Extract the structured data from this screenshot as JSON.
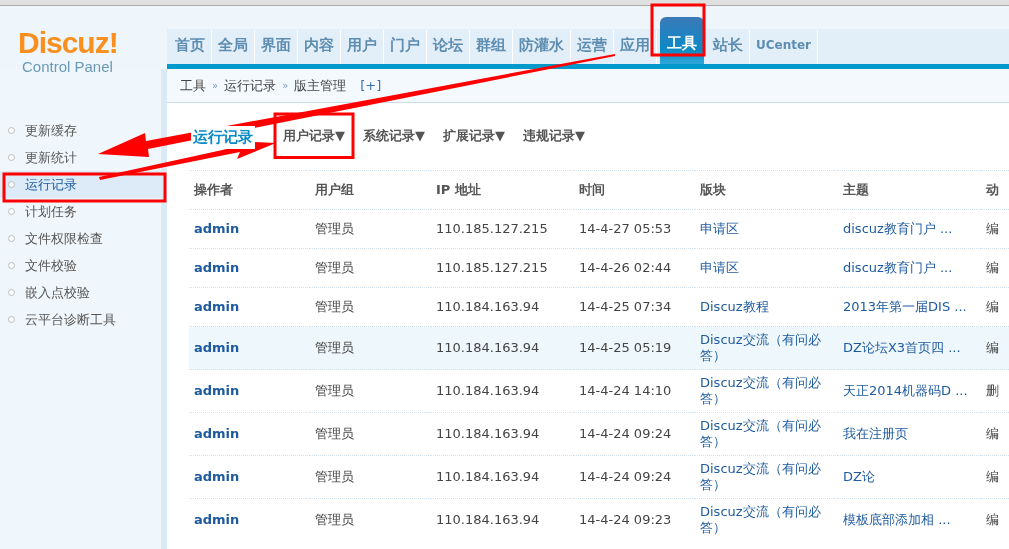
{
  "logo": {
    "title": "Discuz!",
    "subtitle": "Control Panel"
  },
  "nav": [
    {
      "label": "首页",
      "selected": false
    },
    {
      "label": "全局",
      "selected": false
    },
    {
      "label": "界面",
      "selected": false
    },
    {
      "label": "内容",
      "selected": false
    },
    {
      "label": "用户",
      "selected": false
    },
    {
      "label": "门户",
      "selected": false
    },
    {
      "label": "论坛",
      "selected": false
    },
    {
      "label": "群组",
      "selected": false
    },
    {
      "label": "防灌水",
      "selected": false
    },
    {
      "label": "运营",
      "selected": false
    },
    {
      "label": "应用",
      "selected": false
    },
    {
      "label": "工具",
      "selected": true
    },
    {
      "label": "站长",
      "selected": false
    },
    {
      "label": "UCenter",
      "selected": false
    }
  ],
  "breadcrumb": {
    "items": [
      "工具",
      "运行记录",
      "版主管理"
    ],
    "separator": "»",
    "add": "[+]"
  },
  "sidebar": {
    "items": [
      {
        "label": "更新缓存",
        "selected": false
      },
      {
        "label": "更新统计",
        "selected": false
      },
      {
        "label": "运行记录",
        "selected": true
      },
      {
        "label": "计划任务",
        "selected": false
      },
      {
        "label": "文件权限检查",
        "selected": false
      },
      {
        "label": "文件校验",
        "selected": false
      },
      {
        "label": "嵌入点校验",
        "selected": false
      },
      {
        "label": "云平台诊断工具",
        "selected": false
      }
    ]
  },
  "subnav": {
    "title": "运行记录",
    "menus": [
      "用户记录",
      "系统记录",
      "扩展记录",
      "违规记录"
    ],
    "caret": "▼"
  },
  "table": {
    "columns": [
      "操作者",
      "用户组",
      "IP 地址",
      "时间",
      "版块",
      "主题",
      "动"
    ],
    "rows": [
      {
        "cells": [
          "admin",
          "管理员",
          "110.185.127.215",
          "14-4-27 05:53",
          "申请区",
          "discuz教育门户 ...",
          "编"
        ],
        "hovered": false
      },
      {
        "cells": [
          "admin",
          "管理员",
          "110.185.127.215",
          "14-4-26 02:44",
          "申请区",
          "discuz教育门户 ...",
          "编"
        ],
        "hovered": false
      },
      {
        "cells": [
          "admin",
          "管理员",
          "110.184.163.94",
          "14-4-25 07:34",
          "Discuz教程",
          "2013年第一届DIS ...",
          "编"
        ],
        "hovered": false
      },
      {
        "cells": [
          "admin",
          "管理员",
          "110.184.163.94",
          "14-4-25 05:19",
          "Discuz交流（有问必答）",
          "DZ论坛X3首页四 ...",
          "编"
        ],
        "hovered": true
      },
      {
        "cells": [
          "admin",
          "管理员",
          "110.184.163.94",
          "14-4-24 14:10",
          "Discuz交流（有问必答）",
          "天正2014机器码D ...",
          "删"
        ],
        "hovered": false
      },
      {
        "cells": [
          "admin",
          "管理员",
          "110.184.163.94",
          "14-4-24 09:24",
          "Discuz交流（有问必答）",
          "我在注册页",
          "编"
        ],
        "hovered": false
      },
      {
        "cells": [
          "admin",
          "管理员",
          "110.184.163.94",
          "14-4-24 09:24",
          "Discuz交流（有问必答）",
          "DZ论",
          "编"
        ],
        "hovered": false
      },
      {
        "cells": [
          "admin",
          "管理员",
          "110.184.163.94",
          "14-4-24 09:23",
          "Discuz交流（有问必答）",
          "模板底部添加相 ...",
          "编"
        ],
        "hovered": false
      }
    ]
  }
}
